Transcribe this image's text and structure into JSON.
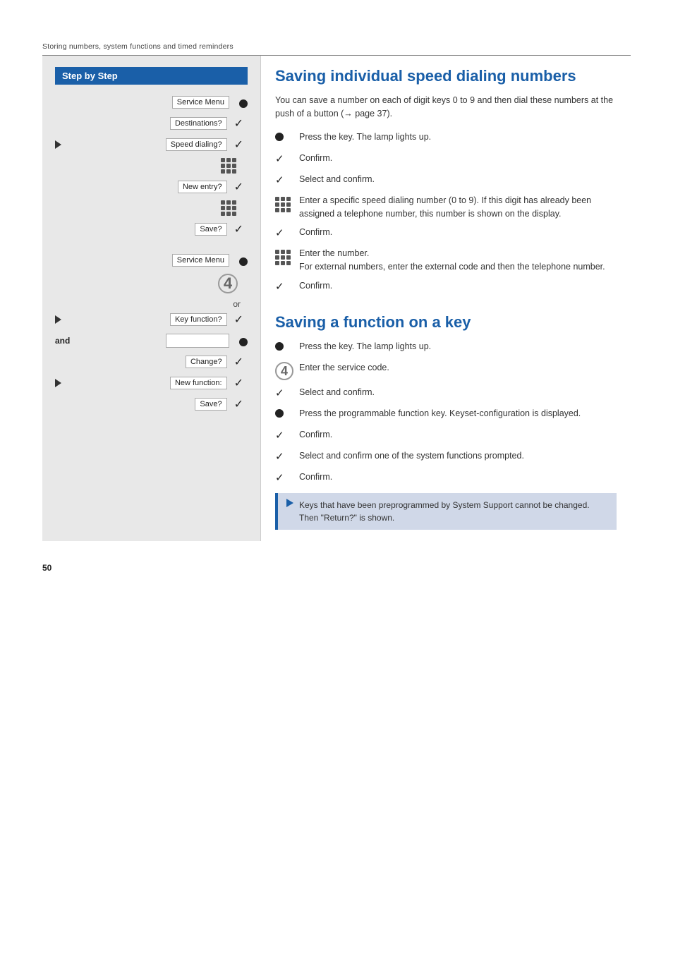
{
  "header": {
    "section_label": "Storing numbers, system functions and timed reminders"
  },
  "left_col": {
    "header": "Step by Step",
    "section1": {
      "rows": [
        {
          "type": "label_circle",
          "label": "Service Menu",
          "has_arrow": false
        },
        {
          "type": "label_check",
          "label": "Destinations?"
        },
        {
          "type": "arrow_label_check",
          "label": "Speed dialing?"
        },
        {
          "type": "numpad_only"
        },
        {
          "type": "label_check",
          "label": "New entry?"
        },
        {
          "type": "numpad_only"
        },
        {
          "type": "label_check",
          "label": "Save?"
        }
      ]
    },
    "section2": {
      "rows": [
        {
          "type": "label_circle",
          "label": "Service Menu"
        },
        {
          "type": "number4"
        },
        {
          "type": "or_text"
        },
        {
          "type": "arrow_label_check",
          "label": "Key function?"
        },
        {
          "type": "and_blank_circle"
        },
        {
          "type": "label_check",
          "label": "Change?"
        },
        {
          "type": "arrow_label_check",
          "label": "New function:"
        },
        {
          "type": "label_check",
          "label": "Save?"
        }
      ]
    }
  },
  "right_col": {
    "title1": "Saving individual speed dialing numbers",
    "intro1": "You can save a number on each of digit keys 0 to 9 and then dial these numbers at the push of a button (→ page 37).",
    "instructions1": [
      {
        "icon": "circle",
        "text": "Press the key. The lamp lights up."
      },
      {
        "icon": "check",
        "text": "Confirm."
      },
      {
        "icon": "check",
        "text": "Select and confirm."
      },
      {
        "icon": "numpad",
        "text": "Enter a specific speed dialing number (0 to 9). If this digit has already been assigned a telephone number, this number is shown on the display."
      },
      {
        "icon": "check",
        "text": "Confirm."
      },
      {
        "icon": "numpad",
        "text": "Enter the number.\nFor external numbers, enter the external code and then the telephone number."
      },
      {
        "icon": "check",
        "text": "Confirm."
      }
    ],
    "title2": "Saving a function on a key",
    "instructions2": [
      {
        "icon": "circle",
        "text": "Press the key. The lamp lights up."
      },
      {
        "icon": "num4",
        "text": "Enter the service code."
      },
      {
        "icon": "check",
        "text": "Select and confirm."
      },
      {
        "icon": "circle",
        "text": "Press the programmable function key. Keyset-configuration is displayed."
      },
      {
        "icon": "check",
        "text": "Confirm."
      },
      {
        "icon": "check",
        "text": "Select and confirm one of the system functions prompted."
      },
      {
        "icon": "check",
        "text": "Confirm."
      }
    ],
    "note": "Keys that have been preprogrammed by System Support cannot be changed. Then \"Return?\" is shown."
  },
  "page_number": "50"
}
